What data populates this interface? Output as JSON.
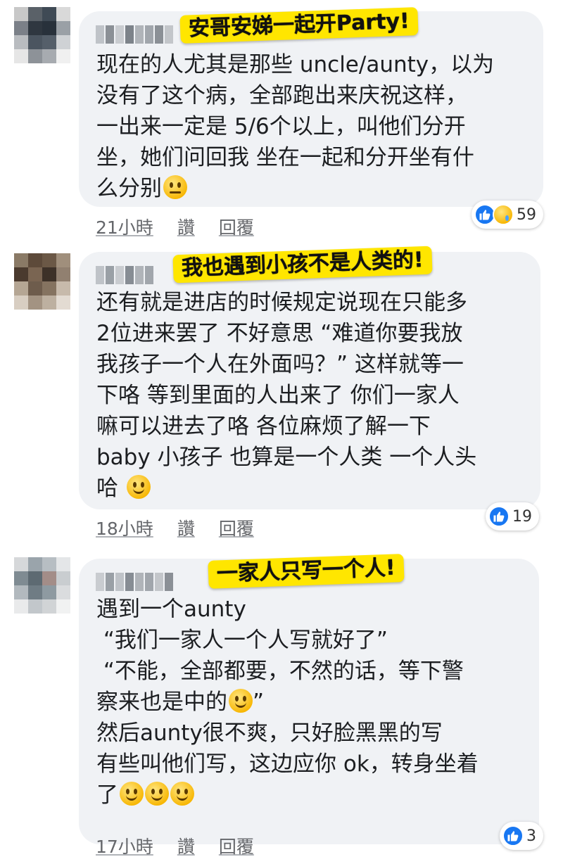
{
  "comments": [
    {
      "sticker": "安哥安娣一起开Party!",
      "lines": [
        "现在的人尤其是那些 uncle/aunty，以为",
        "没有了这个病，全部跑出来庆祝这样，",
        "一出来一定是 5/6个以上，叫他们分开",
        "坐，她们问回我 坐在一起和分开坐有什",
        "么分别"
      ],
      "emoji": "unamused-face-emoji",
      "reaction_count": "59",
      "reaction_icons": [
        "like-icon",
        "sad-icon"
      ],
      "time": "21小時",
      "like_label": "讚",
      "reply_label": "回覆"
    },
    {
      "sticker": "我也遇到小孩不是人类的!",
      "lines": [
        "还有就是进店的时候规定说现在只能多",
        "2位进来罢了 不好意思 “难道你要我放",
        "我孩子一个人在外面吗？” 这样就等一",
        "下咯 等到里面的人出来了 你们一家人",
        "嘛可以进去了咯 各位麻烦了解一下",
        "baby 小孩子 也算是一个人类 一个人头",
        "哈"
      ],
      "emoji": "slightly-smiling-face-emoji",
      "reaction_count": "19",
      "reaction_icons": [
        "like-icon"
      ],
      "time": "18小時",
      "like_label": "讚",
      "reply_label": "回覆"
    },
    {
      "sticker": "一家人只写一个人!",
      "lines": [
        "遇到一个aunty",
        " “我们一家人一个人写就好了”",
        " “不能，全部都要，不然的话，等下警",
        "察来也是中的",
        "然后aunty很不爽，只好脸黑黑的写",
        "有些叫他们写，这边应你 ok，转身坐着",
        "了"
      ],
      "line4_suffix": "”",
      "emoji": "slightly-smiling-face-emoji",
      "reaction_count": "3",
      "reaction_icons": [
        "like-icon"
      ],
      "time": "17小時",
      "like_label": "讚",
      "reply_label": "回覆"
    }
  ],
  "colors": {
    "bubble": "#f0f2f5",
    "sticker": "#ffe600",
    "like_blue": "#1877f2",
    "meta_gray": "#65676b"
  }
}
